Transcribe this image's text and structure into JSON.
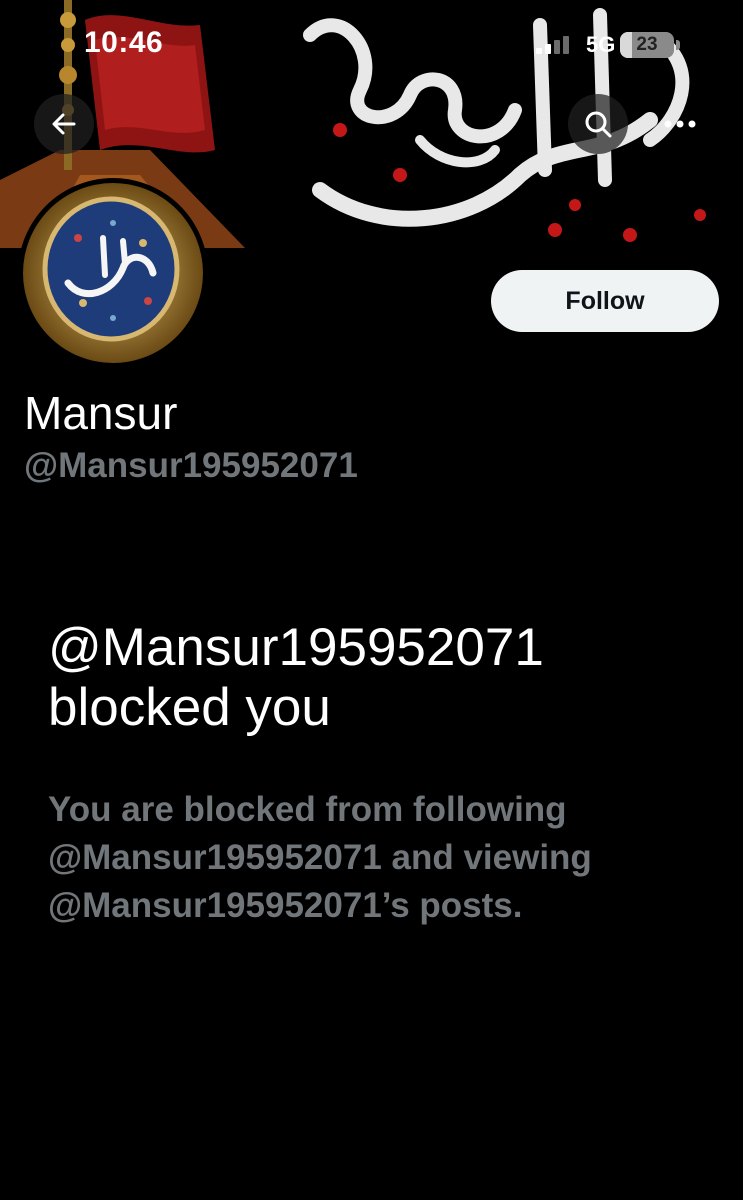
{
  "status_bar": {
    "time": "10:46",
    "network": "5G",
    "battery": "23",
    "battery_level": 0.23
  },
  "banner": {
    "description_icon": "calligraphy-banner"
  },
  "nav": {
    "back_icon": "back-arrow-icon",
    "search_icon": "search-icon",
    "more_icon": "more-options-icon"
  },
  "profile": {
    "display_name": "Mansur",
    "handle": "@Mansur195952071",
    "follow_label": "Follow"
  },
  "blocked": {
    "title_line1": "@Mansur195952071",
    "title_line2": "blocked you",
    "description": "You are blocked from following @Mansur195952071 and viewing @Mansur195952071’s posts."
  },
  "colors": {
    "background": "#000000",
    "secondary_text": "#71767b",
    "follow_button_bg": "#eff3f4"
  }
}
